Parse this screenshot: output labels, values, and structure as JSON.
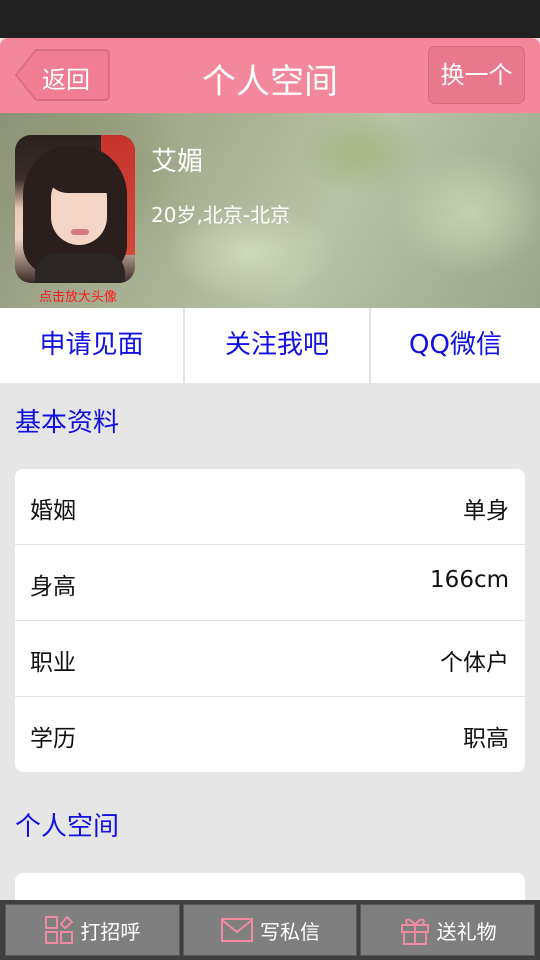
{
  "header": {
    "back_label": "返回",
    "title": "个人空间",
    "switch_label": "换一个"
  },
  "profile": {
    "name": "艾媚",
    "info": "20岁,北京-北京",
    "avatar_caption": "点击放大头像"
  },
  "actions": [
    {
      "label": "申请见面"
    },
    {
      "label": "关注我吧"
    },
    {
      "label": "QQ微信"
    }
  ],
  "basic_info": {
    "title": "基本资料",
    "rows": [
      {
        "label": "婚姻",
        "value": "单身"
      },
      {
        "label": "身高",
        "value": "166cm"
      },
      {
        "label": "职业",
        "value": "个体户"
      },
      {
        "label": "学历",
        "value": "职高"
      }
    ]
  },
  "space_section": {
    "title": "个人空间"
  },
  "bottom_bar": [
    {
      "label": "打招呼",
      "icon": "greet-icon"
    },
    {
      "label": "写私信",
      "icon": "mail-icon"
    },
    {
      "label": "送礼物",
      "icon": "gift-icon"
    }
  ],
  "colors": {
    "header_pink": "#f3879b",
    "link_blue": "#1010e6",
    "caption_red": "#ff1a1a",
    "icon_pink": "#f08aa0"
  }
}
